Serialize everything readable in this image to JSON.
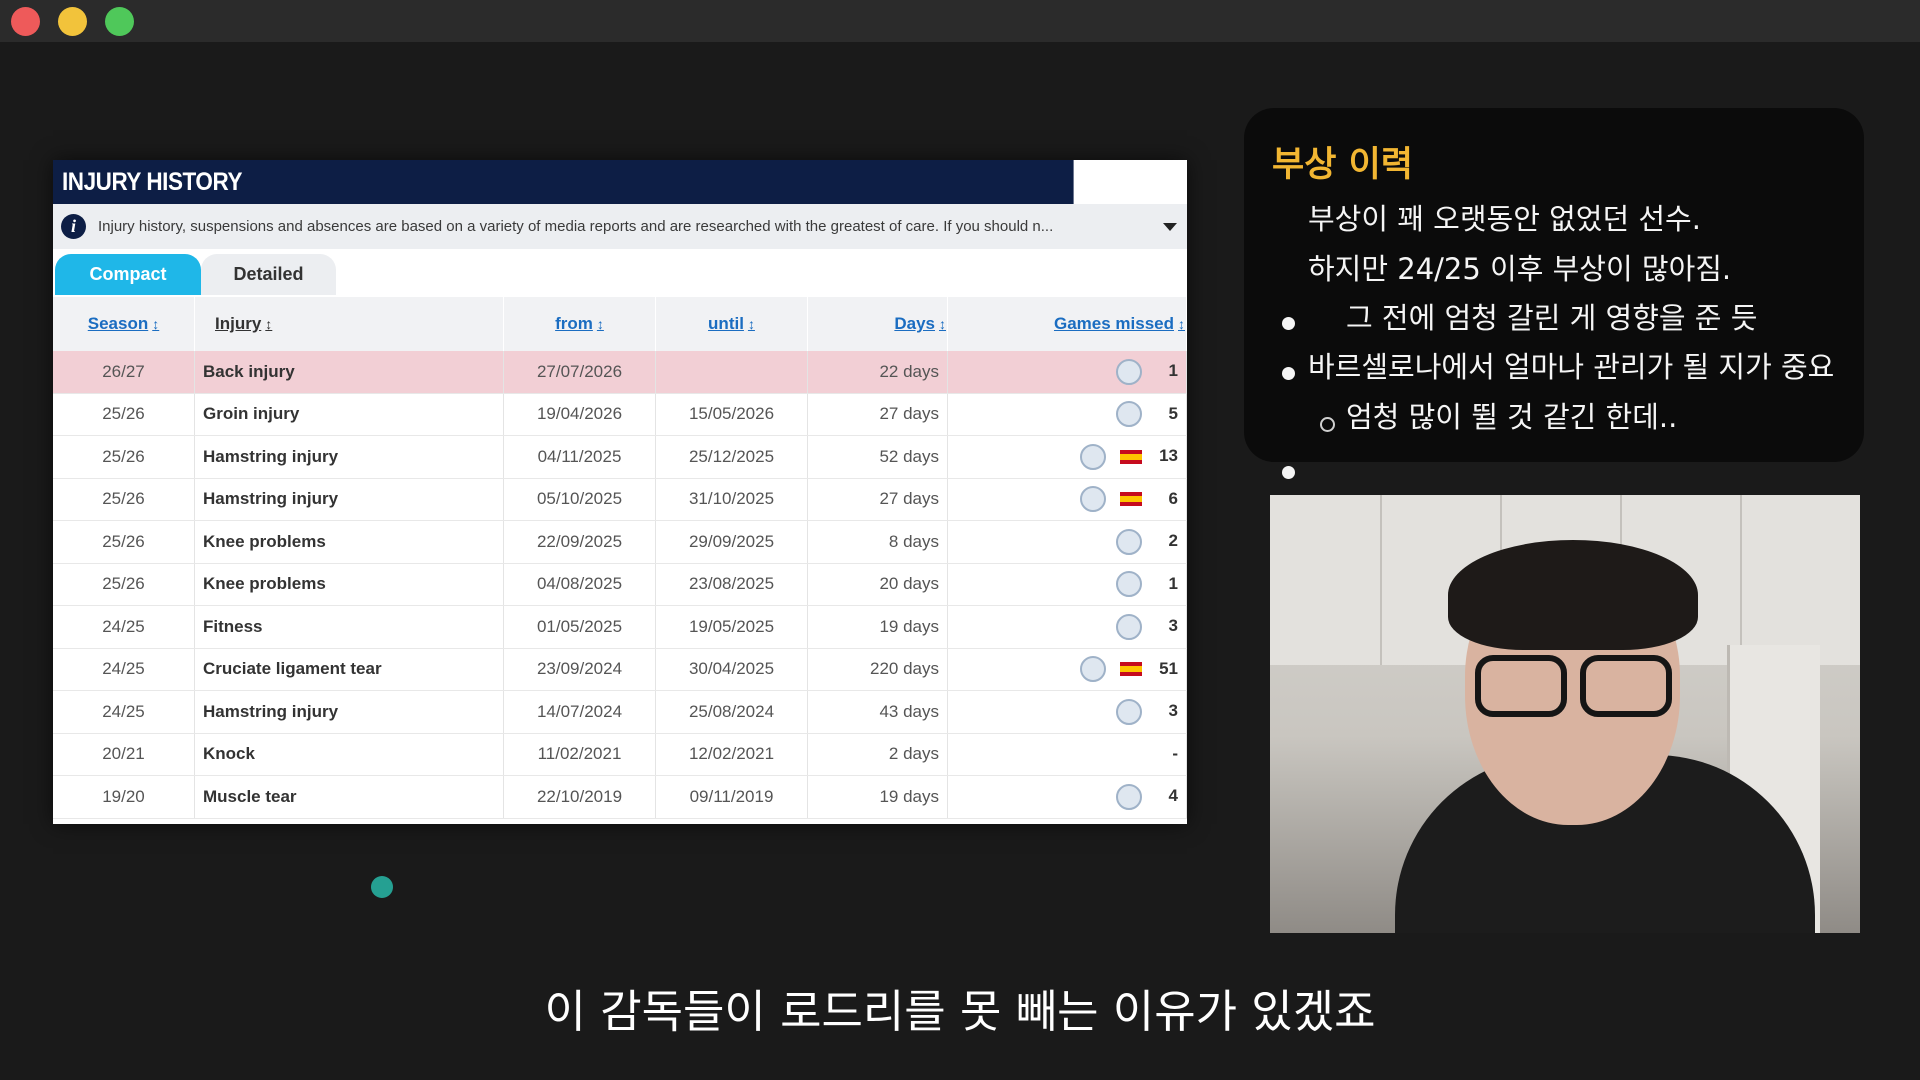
{
  "injury_panel": {
    "title": "INJURY HISTORY",
    "info_text": "Injury history, suspensions and absences are based on a variety of media reports and are researched with the greatest of care. If you should n...",
    "tabs": [
      "Compact",
      "Detailed"
    ],
    "columns": {
      "season": "Season",
      "injury": "Injury",
      "from": "from",
      "until": "until",
      "days": "Days",
      "games_missed": "Games missed"
    },
    "rows": [
      {
        "season": "26/27",
        "injury": "Back injury",
        "from": "27/07/2026",
        "until": "",
        "days": "22 days",
        "games": "1",
        "clubs": [
          "crest"
        ]
      },
      {
        "season": "25/26",
        "injury": "Groin injury",
        "from": "19/04/2026",
        "until": "15/05/2026",
        "days": "27 days",
        "games": "5",
        "clubs": [
          "crest"
        ]
      },
      {
        "season": "25/26",
        "injury": "Hamstring injury",
        "from": "04/11/2025",
        "until": "25/12/2025",
        "days": "52 days",
        "games": "13",
        "clubs": [
          "crest",
          "spain-flag"
        ]
      },
      {
        "season": "25/26",
        "injury": "Hamstring injury",
        "from": "05/10/2025",
        "until": "31/10/2025",
        "days": "27 days",
        "games": "6",
        "clubs": [
          "crest",
          "spain-flag"
        ]
      },
      {
        "season": "25/26",
        "injury": "Knee problems",
        "from": "22/09/2025",
        "until": "29/09/2025",
        "days": "8 days",
        "games": "2",
        "clubs": [
          "crest"
        ]
      },
      {
        "season": "25/26",
        "injury": "Knee problems",
        "from": "04/08/2025",
        "until": "23/08/2025",
        "days": "20 days",
        "games": "1",
        "clubs": [
          "crest"
        ]
      },
      {
        "season": "24/25",
        "injury": "Fitness",
        "from": "01/05/2025",
        "until": "19/05/2025",
        "days": "19 days",
        "games": "3",
        "clubs": [
          "crest"
        ]
      },
      {
        "season": "24/25",
        "injury": "Cruciate ligament tear",
        "from": "23/09/2024",
        "until": "30/04/2025",
        "days": "220 days",
        "games": "51",
        "clubs": [
          "crest",
          "spain-flag"
        ]
      },
      {
        "season": "24/25",
        "injury": "Hamstring injury",
        "from": "14/07/2024",
        "until": "25/08/2024",
        "days": "43 days",
        "games": "3",
        "clubs": [
          "crest"
        ]
      },
      {
        "season": "20/21",
        "injury": "Knock",
        "from": "11/02/2021",
        "until": "12/02/2021",
        "days": "2 days",
        "games": "-",
        "clubs": []
      },
      {
        "season": "19/20",
        "injury": "Muscle tear",
        "from": "22/10/2019",
        "until": "09/11/2019",
        "days": "19 days",
        "games": "4",
        "clubs": [
          "crest"
        ]
      }
    ],
    "highlight_color": "#f2cfd5",
    "header_color": "#0d1e45",
    "tab_active_color": "#1fb7e8"
  },
  "notes": {
    "title": "부상 이력",
    "items": [
      {
        "level": 1,
        "text": "부상이 꽤 오랫동안 없었던 선수."
      },
      {
        "level": 1,
        "text": "하지만 24/25 이후 부상이 많아짐."
      },
      {
        "level": 2,
        "text": "그 전에 엄청 갈린 게 영향을 준 듯"
      },
      {
        "level": 1,
        "text": "바르셀로나에서 얼마나 관리가 될 지가 중요"
      },
      {
        "level": 2,
        "text": "엄청 많이 뛸 것 같긴 한데.."
      }
    ],
    "title_color": "#f2b632"
  },
  "subtitle": "이 감독들이 로드리를 못 빼는 이유가 있겠죠"
}
